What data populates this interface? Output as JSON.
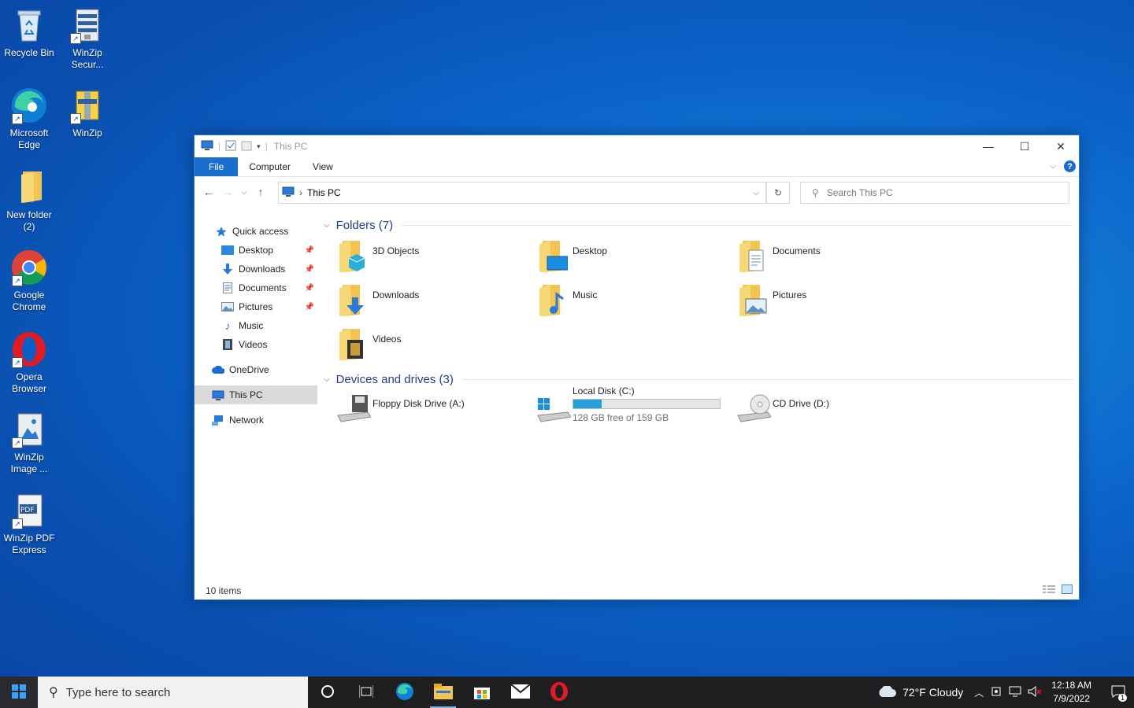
{
  "desktop": {
    "icons": [
      {
        "label": "Recycle Bin"
      },
      {
        "label": "WinZip Secur..."
      },
      {
        "label": "Microsoft Edge"
      },
      {
        "label": "WinZip"
      },
      {
        "label": "New folder (2)"
      },
      {
        "label": "Google Chrome"
      },
      {
        "label": "Opera Browser"
      },
      {
        "label": "WinZip Image ..."
      },
      {
        "label": "WinZip PDF Express"
      }
    ]
  },
  "window": {
    "title": "This PC",
    "ribbon": {
      "file": "File",
      "computer": "Computer",
      "view": "View",
      "help": "?"
    },
    "address": {
      "path": "This PC"
    },
    "search": {
      "placeholder": "Search This PC"
    },
    "nav": {
      "quick_access": "Quick access",
      "items": [
        "Desktop",
        "Downloads",
        "Documents",
        "Pictures",
        "Music",
        "Videos"
      ],
      "onedrive": "OneDrive",
      "this_pc": "This PC",
      "network": "Network"
    },
    "folders": {
      "header": "Folders (7)",
      "items": [
        "3D Objects",
        "Desktop",
        "Documents",
        "Downloads",
        "Music",
        "Pictures",
        "Videos"
      ]
    },
    "drives": {
      "header": "Devices and drives (3)",
      "floppy": "Floppy Disk Drive (A:)",
      "local": {
        "name": "Local Disk (C:)",
        "free": "128 GB free of 159 GB",
        "used_fraction": 0.195
      },
      "cd": "CD Drive (D:)"
    },
    "status": "10 items"
  },
  "taskbar": {
    "search_placeholder": "Type here to search",
    "weather": "72°F  Cloudy",
    "time": "12:18 AM",
    "date": "7/9/2022",
    "notifications": "1"
  },
  "colors": {
    "accent": "#1a6ecc",
    "folder": "#f3c451",
    "taskbar": "#1f1f22"
  }
}
